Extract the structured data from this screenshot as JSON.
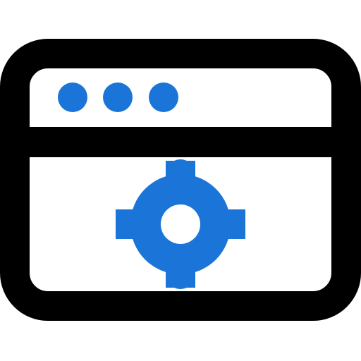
{
  "icon": {
    "name": "browser-window-target-icon",
    "stroke_color": "#000000",
    "accent_color": "#1b75d8",
    "background_color": "#ffffff"
  },
  "titlebar": {
    "dot_count": 3,
    "dot_icon": "window-control-dot"
  },
  "content": {
    "symbol_icon": "crosshair-target-icon"
  }
}
